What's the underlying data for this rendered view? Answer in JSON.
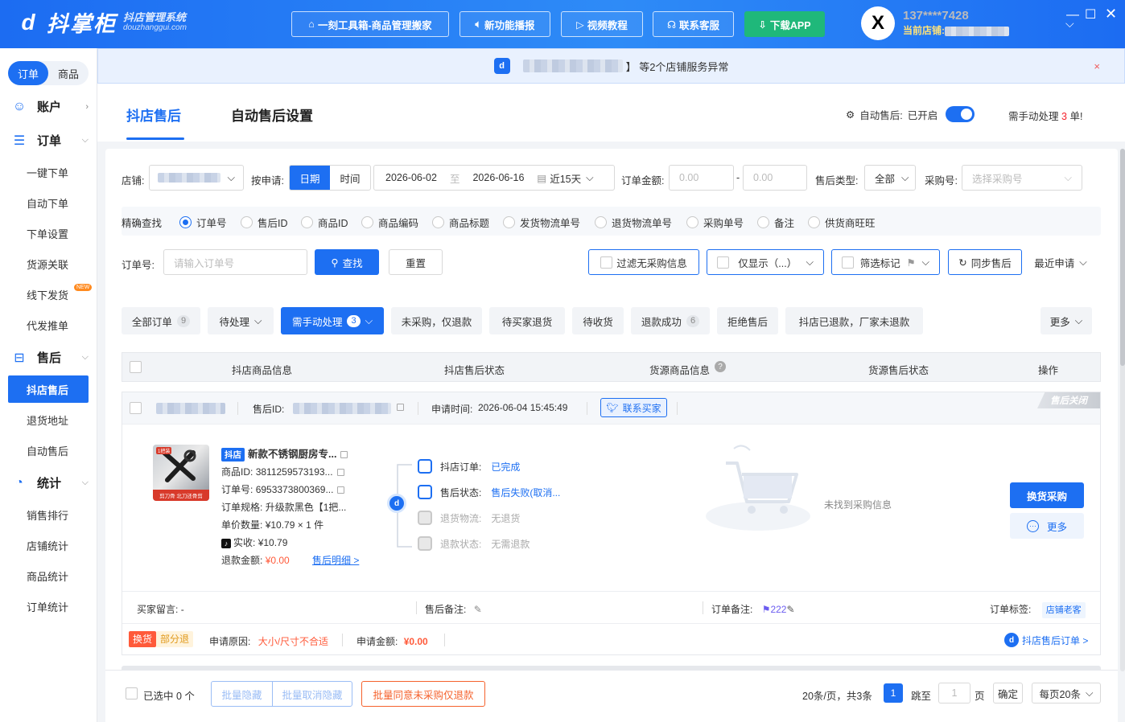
{
  "topbar": {
    "logo_mark": "d",
    "logo_name": "抖掌柜",
    "logo_sub1": "抖店管理系统",
    "logo_sub2": "douzhanggui.com",
    "buttons": [
      "一刻工具箱-商品管理搬家",
      "新功能播报",
      "视频教程",
      "联系客服",
      "下载APP"
    ],
    "user_avatar": "X",
    "user_phone": "137****7428",
    "current_store_label": "当前店铺:"
  },
  "sidebar": {
    "tabs": [
      "订单",
      "商品"
    ],
    "account": "账户",
    "order_group": "订单",
    "order_items": [
      "一键下单",
      "自动下单",
      "下单设置",
      "货源关联",
      "线下发货",
      "代发推单"
    ],
    "new_tag": "NEW",
    "aftersale_group": "售后",
    "aftersale_items": [
      "抖店售后",
      "退货地址",
      "自动售后"
    ],
    "stats_group": "统计",
    "stats_items": [
      "销售排行",
      "店铺统计",
      "商品统计",
      "订单统计"
    ]
  },
  "notice": {
    "text_suffix": "】 等2个店铺服务异常",
    "close": "×"
  },
  "header": {
    "tab_active": "抖店售后",
    "tab_other": "自动售后设置",
    "auto_label": "自动售后:",
    "auto_state": "已开启",
    "need_prefix": "需手动处理",
    "need_count": "3",
    "need_suffix": "单!"
  },
  "filters": {
    "store_label": "店铺:",
    "apply_label": "按申请:",
    "seg_date": "日期",
    "seg_time": "时间",
    "date_start": "2026-06-02",
    "date_to": "至",
    "date_end": "2026-06-16",
    "date_range": "近15天",
    "amount_label": "订单金额:",
    "amount_min_ph": "0.00",
    "amount_dash": "-",
    "amount_max_ph": "0.00",
    "type_label": "售后类型:",
    "type_value": "全部",
    "purchase_label": "采购号:",
    "purchase_ph": "选择采购号",
    "exact_label": "精确查找",
    "exact_options": [
      "订单号",
      "售后ID",
      "商品ID",
      "商品编码",
      "商品标题",
      "发货物流单号",
      "退货物流单号",
      "采购单号",
      "备注",
      "供货商旺旺"
    ],
    "order_no_label": "订单号:",
    "order_no_ph": "请输入订单号",
    "search_btn": "查找",
    "reset_btn": "重置",
    "filter_no_purchase": "过滤无采购信息",
    "only_show": "仅显示（...）",
    "filter_mark": "筛选标记",
    "sync_btn": "同步售后",
    "recent_apply": "最近申请"
  },
  "status_tabs": [
    {
      "label": "全部订单",
      "count": "9"
    },
    {
      "label": "待处理",
      "count": ""
    },
    {
      "label": "需手动处理",
      "count": "3"
    },
    {
      "label": "未采购，仅退款",
      "count": ""
    },
    {
      "label": "待买家退货",
      "count": ""
    },
    {
      "label": "待收货",
      "count": ""
    },
    {
      "label": "退款成功",
      "count": "6"
    },
    {
      "label": "拒绝售后",
      "count": ""
    },
    {
      "label": "抖店已退款，厂家未退款",
      "count": ""
    },
    {
      "label": "更多",
      "count": ""
    }
  ],
  "table": {
    "headers": [
      "抖店商品信息",
      "抖店售后状态",
      "货源商品信息",
      "货源售后状态",
      "操作"
    ],
    "row": {
      "closed_badge": "售后关闭",
      "aftersale_id_label": "售后ID:",
      "apply_time_label": "申请时间:",
      "apply_time": "2026-06-04 15:45:49",
      "contact_buyer": "联系买家",
      "shop_badge": "抖店",
      "title": "新款不锈钢厨房专...",
      "product_id_label": "商品ID:",
      "product_id": "3811259573193...",
      "order_no_label": "订单号:",
      "order_no": "6953373800369...",
      "spec_label": "订单规格:",
      "spec": "升级款黑色【1把...",
      "unit_label": "单价数量:",
      "unit": "¥10.79 × 1 件",
      "paid_label": "实收:",
      "paid": "¥10.79",
      "refund_label": "退款金额:",
      "refund": "¥0.00",
      "detail_link": "售后明细 >",
      "thumb_caption": "剪刀骨 北刀还骨剪",
      "thumb_tag": "1把装",
      "status": [
        {
          "label": "抖店订单:",
          "value": "已完成"
        },
        {
          "label": "售后状态:",
          "value": "售后失败(取消..."
        },
        {
          "label": "退货物流:",
          "value": "无退货"
        },
        {
          "label": "退款状态:",
          "value": "无需退款"
        }
      ],
      "no_purchase": "未找到采购信息",
      "btn_exchange": "换货采购",
      "btn_more": "更多",
      "buyer_msg_label": "买家留言:",
      "buyer_msg": "-",
      "aftersale_note_label": "售后备注:",
      "order_note_label": "订单备注:",
      "order_note": "222",
      "order_tag_label": "订单标签:",
      "order_tag": "店铺老客",
      "tag_exchange": "换货",
      "tag_partial": "部分退",
      "reason_label": "申请原因:",
      "reason": "大小/尺寸不合适",
      "apply_amount_label": "申请金额:",
      "apply_amount": "¥0.00",
      "aftersale_order_link": "抖店售后订单 >"
    }
  },
  "bottom": {
    "selected": "已选中 0 个",
    "batch_hide": "批量隐藏",
    "batch_unhide": "批量取消隐藏",
    "batch_agree": "批量同意未采购仅退款",
    "per_page_info": "20条/页，共3条",
    "page": "1",
    "jump_label": "跳至",
    "jump_value": "1",
    "page_unit": "页",
    "confirm": "确定",
    "per_page_select": "每页20条"
  }
}
